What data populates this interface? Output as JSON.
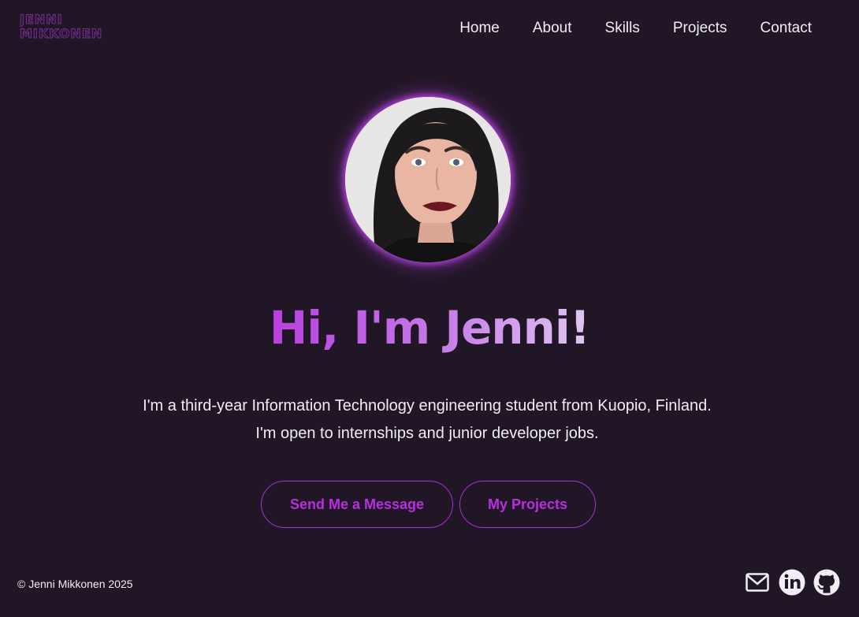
{
  "logo": {
    "line1": "JENNI",
    "line2": "MIKKONEN",
    "color": "#6d2a86"
  },
  "nav": {
    "items": [
      "Home",
      "About",
      "Skills",
      "Projects",
      "Contact"
    ]
  },
  "hero": {
    "avatar_alt": "Profile photo of Jenni",
    "title": "Hi, I'm Jenni!",
    "intro_line1": "I'm a third-year Information Technology engineering student from Kuopio, Finland.",
    "intro_line2": "I'm open to internships and junior developer jobs."
  },
  "actions": {
    "message_label": "Send Me a Message",
    "projects_label": "My Projects"
  },
  "footer": {
    "copyright": "© Jenni Mikkonen 2025",
    "social_icons": [
      "mail-icon",
      "linkedin-icon",
      "github-icon"
    ]
  },
  "colors": {
    "background": "#211625",
    "accent": "#b82fe0",
    "text": "#f1eef3"
  }
}
